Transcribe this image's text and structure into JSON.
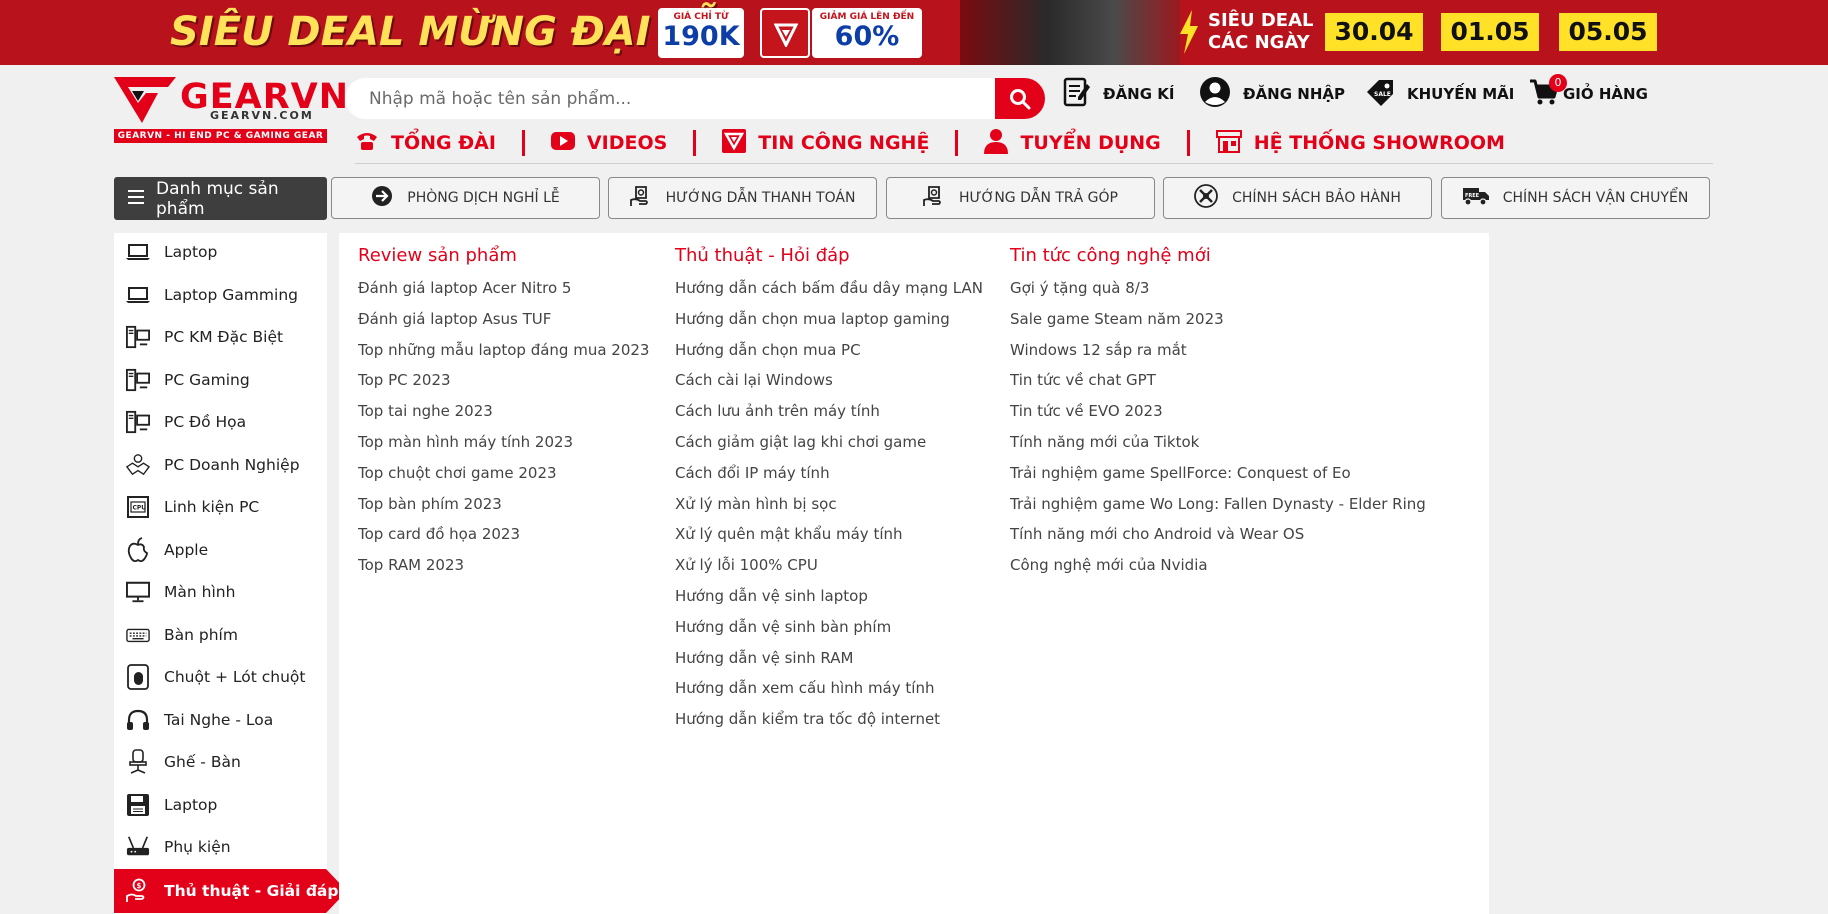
{
  "banner": {
    "title": "SIÊU DEAL MỪNG ĐẠI LỄ",
    "price_small": "GIÁ CHỈ TỪ",
    "price_big": "190K",
    "discount_small": "GIẢM GIÁ LÊN ĐẾN",
    "discount_big": "60%",
    "deal_line1": "SIÊU DEAL",
    "deal_line2": "CÁC NGÀY",
    "dates": [
      "30.04",
      "01.05",
      "05.05"
    ]
  },
  "logo": {
    "brand": "GEARVN",
    "brand_sub": "GEARVN.COM",
    "tagline": "GEARVN - HI END PC & GAMING GEAR"
  },
  "search": {
    "placeholder": "Nhập mã hoặc tên sản phẩm..."
  },
  "top_links": {
    "register": "ĐĂNG KÍ",
    "login": "ĐĂNG NHẬP",
    "promo": "KHUYẾN MÃI",
    "cart": "GIỎ HÀNG",
    "cart_count": "0"
  },
  "nav": {
    "hotline": "TỔNG ĐÀI",
    "videos": "VIDEOS",
    "tech_news": "TIN CÔNG NGHỆ",
    "recruit": "TUYỂN DỤNG",
    "showroom": "HỆ THỐNG SHOWROOM"
  },
  "category_button": "Danh mục sản phẩm",
  "pills": {
    "holiday": "PHÒNG DỊCH NGHỈ LỄ",
    "payment": "HƯỚNG DẪN THANH TOÁN",
    "installment": "HƯỚNG DẪN TRẢ GÓP",
    "warranty": "CHÍNH SÁCH BẢO HÀNH",
    "shipping": "CHÍNH SÁCH VẬN CHUYỂN"
  },
  "sidebar": {
    "items": [
      {
        "label": "Laptop",
        "icon": "laptop-icon"
      },
      {
        "label": "Laptop Gamming",
        "icon": "laptop-icon"
      },
      {
        "label": "PC KM Đặc Biệt",
        "icon": "pc-icon"
      },
      {
        "label": "PC Gaming",
        "icon": "pc-icon"
      },
      {
        "label": "PC Đồ Họa",
        "icon": "pc-icon"
      },
      {
        "label": "PC Doanh Nghiệp",
        "icon": "handshake-icon"
      },
      {
        "label": "Linh kiện PC",
        "icon": "cpu-icon"
      },
      {
        "label": "Apple",
        "icon": "apple-icon"
      },
      {
        "label": "Màn hình",
        "icon": "monitor-icon"
      },
      {
        "label": "Bàn phím",
        "icon": "keyboard-icon"
      },
      {
        "label": "Chuột + Lót chuột",
        "icon": "mouse-icon"
      },
      {
        "label": "Tai Nghe - Loa",
        "icon": "headphone-icon"
      },
      {
        "label": "Ghế - Bàn",
        "icon": "chair-icon"
      },
      {
        "label": "Laptop",
        "icon": "floppy-icon"
      },
      {
        "label": "Phụ kiện",
        "icon": "router-icon"
      },
      {
        "label": "Thủ thuật - Giải đáp",
        "icon": "hand-coin-icon"
      }
    ]
  },
  "menu": {
    "col1": {
      "title": "Review sản phẩm",
      "links": [
        "Đánh giá laptop Acer Nitro 5",
        "Đánh giá laptop Asus TUF",
        "Top những mẫu laptop đáng mua 2023",
        "Top PC 2023",
        "Top tai nghe 2023",
        "Top màn hình máy tính 2023",
        "Top chuột chơi game 2023",
        "Top bàn phím 2023",
        "Top card đồ họa 2023",
        "Top RAM 2023"
      ]
    },
    "col2": {
      "title": "Thủ thuật - Hỏi đáp",
      "links": [
        "Hướng dẫn cách bấm đầu dây mạng LAN",
        "Hướng dẫn chọn mua laptop gaming",
        "Hướng dẫn chọn mua PC",
        "Cách cài lại Windows",
        "Cách lưu ảnh trên máy tính",
        "Cách giảm giật lag khi chơi game",
        "Cách đổi IP máy tính",
        "Xử lý màn hình bị sọc",
        "Xử lý quên mật khẩu máy tính",
        "Xử lý lỗi 100% CPU",
        "Hướng dẫn vệ sinh laptop",
        "Hướng dẫn vệ sinh bàn phím",
        "Hướng dẫn vệ sinh RAM",
        "Hướng dẫn xem cấu hình máy tính",
        "Hướng dẫn kiểm tra tốc độ internet"
      ]
    },
    "col3": {
      "title": "Tin tức công nghệ mới",
      "links": [
        "Gợi ý tặng quà 8/3",
        "Sale game Steam năm 2023",
        "Windows 12 sắp ra mắt",
        "Tin tức về chat GPT",
        "Tin tức về EVO 2023",
        "Tính năng mới của Tiktok",
        "Trải nghiệm game SpellForce: Conquest of Eo",
        "Trải nghiệm game Wo Long: Fallen Dynasty - Elder Ring",
        "Tính năng mới cho Android và Wear OS",
        "Công nghệ mới của Nvidia"
      ]
    }
  },
  "colors": {
    "brand_red": "#e30019",
    "banner_red": "#b8131c",
    "banner_yellow": "#ffe227"
  }
}
